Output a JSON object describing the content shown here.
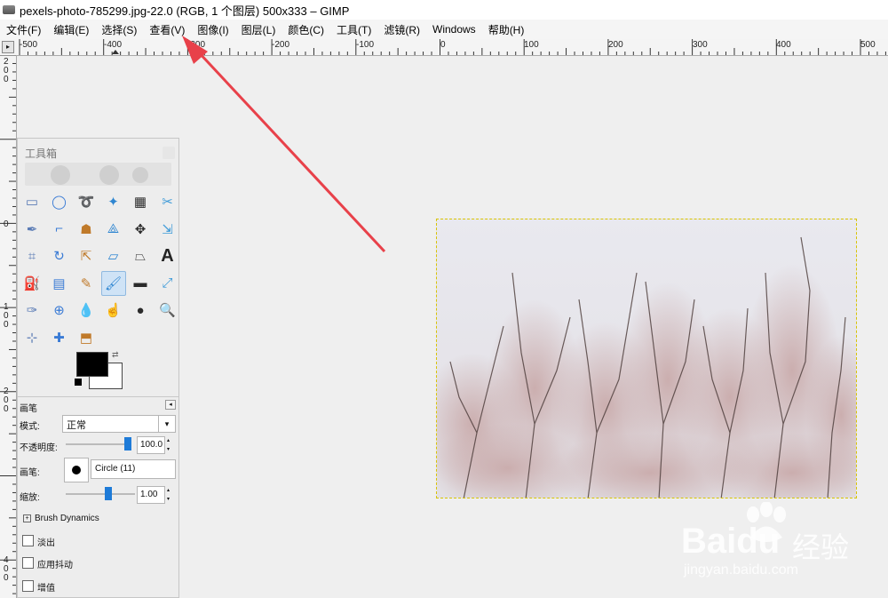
{
  "window": {
    "title": "pexels-photo-785299.jpg-22.0 (RGB, 1 个图层) 500x333 – GIMP"
  },
  "menubar": {
    "items": [
      "文件(F)",
      "编辑(E)",
      "选择(S)",
      "查看(V)",
      "图像(I)",
      "图层(L)",
      "颜色(C)",
      "工具(T)",
      "滤镜(R)",
      "Windows",
      "帮助(H)"
    ]
  },
  "ruler_top": {
    "labels": [
      "-500",
      "-400",
      "-300",
      "-200",
      "-100",
      "0",
      "100",
      "200",
      "300",
      "400",
      "500"
    ]
  },
  "ruler_left": {
    "labels": [
      "2",
      "0",
      "0",
      "0",
      "1",
      "0",
      "0",
      "2",
      "0",
      "0",
      "4",
      "0",
      "0"
    ]
  },
  "toolbox": {
    "title": "工具箱",
    "tool_icons": [
      "rect-select-icon",
      "ellipse-select-icon",
      "lasso-icon",
      "magic-wand-icon",
      "select-by-color-icon",
      "scissors-icon",
      "paths-icon",
      "color-picker-icon",
      "foreground-select-icon",
      "measure-icon",
      "move-icon",
      "align-icon",
      "crop-icon",
      "rotate-icon",
      "scale-icon",
      "shear-icon",
      "perspective-icon",
      "text-icon",
      "bucket-fill-icon",
      "gradient-icon",
      "pencil-icon",
      "paintbrush-icon",
      "eraser-icon",
      "airbrush-icon",
      "ink-icon",
      "clone-icon",
      "blur-icon",
      "smudge-icon",
      "dodge-icon",
      "zoom-icon",
      "flip-icon",
      "heal-icon",
      "perspective-clone-icon"
    ],
    "active_tool": "paintbrush-icon",
    "fg_color": "#000000",
    "bg_color": "#ffffff"
  },
  "tool_options": {
    "title": "画笔",
    "mode_label": "模式:",
    "mode_value": "正常",
    "opacity_label": "不透明度:",
    "opacity_value": "100.0",
    "opacity_fraction": 1.0,
    "brush_label": "画笔:",
    "brush_value": "Circle (11)",
    "scale_label": "缩放:",
    "scale_value": "1.00",
    "dynamics_label": "Brush Dynamics",
    "fade_label": "淡出",
    "jitter_label": "应用抖动",
    "incremental_label": "增值"
  },
  "watermark": {
    "brand": "Baidu",
    "brand_cn": "经验",
    "url": "jingyan.baidu.com"
  },
  "accent": {
    "arrow": "#e8414a",
    "selection": "#d8c400",
    "active_tool_bg": "#cfe3f6"
  }
}
